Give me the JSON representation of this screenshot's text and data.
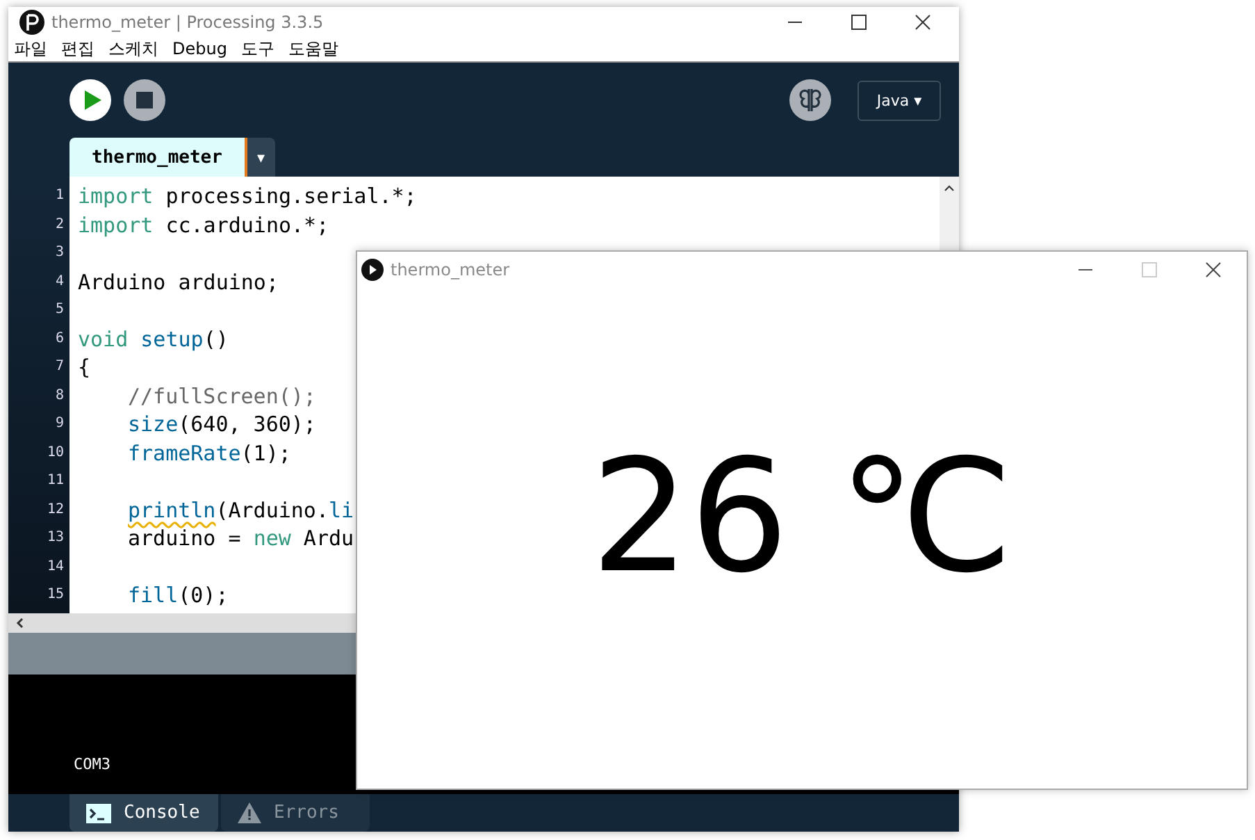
{
  "window": {
    "title": "thermo_meter | Processing 3.3.5"
  },
  "menu": [
    "파일",
    "편집",
    "스케치",
    "Debug",
    "도구",
    "도움말"
  ],
  "toolbar": {
    "mode": "Java ▾"
  },
  "tabs": [
    {
      "label": "thermo_meter",
      "selected": true
    }
  ],
  "tab_menu": "▾",
  "code": [
    {
      "number": "1",
      "tokens": [
        {
          "text": "import",
          "kind": "keyword"
        },
        {
          "text": " processing.serial.*;",
          "kind": "plain"
        }
      ]
    },
    {
      "number": "2",
      "tokens": [
        {
          "text": "import",
          "kind": "keyword"
        },
        {
          "text": " cc.arduino.*;",
          "kind": "plain"
        }
      ]
    },
    {
      "number": "3"
    },
    {
      "number": "4",
      "tokens": [
        {
          "text": "Arduino arduino;",
          "kind": "plain"
        }
      ]
    },
    {
      "number": "5"
    },
    {
      "number": "6",
      "tokens": [
        {
          "text": "void ",
          "kind": "keyword"
        },
        {
          "text": "setup",
          "kind": "function"
        },
        {
          "text": "()",
          "kind": "plain"
        }
      ]
    },
    {
      "number": "7",
      "tokens": [
        {
          "text": "{",
          "kind": "plain"
        }
      ]
    },
    {
      "number": "8",
      "indented": true,
      "tokens": [
        {
          "text": "//fullScreen();",
          "kind": "comment"
        }
      ]
    },
    {
      "number": "9",
      "indented": true,
      "tokens": [
        {
          "text": "size",
          "kind": "function"
        },
        {
          "text": "(640, 360);",
          "kind": "plain"
        }
      ]
    },
    {
      "number": "10",
      "indented": true,
      "tokens": [
        {
          "text": "frameRate",
          "kind": "function"
        },
        {
          "text": "(1);",
          "kind": "plain"
        }
      ]
    },
    {
      "number": "11"
    },
    {
      "number": "12",
      "indented": true,
      "tokens": [
        {
          "text": "println",
          "kind": "warning"
        },
        {
          "text": "(Arduino.",
          "kind": "plain"
        },
        {
          "text": "li",
          "kind": "function"
        }
      ]
    },
    {
      "number": "13",
      "indented": true,
      "tokens": [
        {
          "text": "arduino = ",
          "kind": "plain"
        },
        {
          "text": "new",
          "kind": "keyword"
        },
        {
          "text": " Ardu",
          "kind": "plain"
        }
      ]
    },
    {
      "number": "14"
    },
    {
      "number": "15",
      "indented": true,
      "tokens": [
        {
          "text": "fill",
          "kind": "function"
        },
        {
          "text": "(0);",
          "kind": "plain"
        }
      ]
    }
  ],
  "console": {
    "output": "COM3"
  },
  "footer_tabs": [
    {
      "label": "Console",
      "selected": true,
      "kind": "console"
    },
    {
      "label": "Errors",
      "selected": false,
      "kind": "errors"
    }
  ],
  "sketch_window": {
    "title": "thermo_meter",
    "reading": "26 ℃"
  }
}
